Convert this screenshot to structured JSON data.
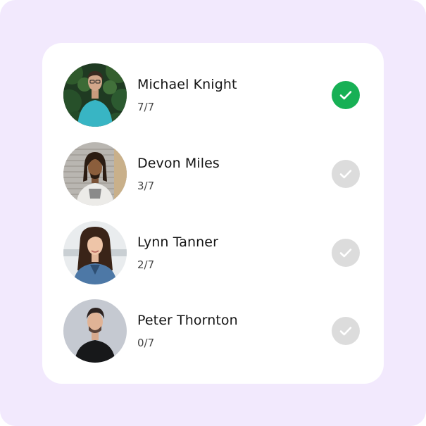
{
  "colors": {
    "background": "#f2e9fd",
    "card": "#ffffff",
    "check_done": "#17b055",
    "check_pending": "#dcdcdc"
  },
  "members": [
    {
      "name": "Michael Knight",
      "score": "7/7",
      "completed": true,
      "avatar": "man-teal-shirt-foliage-photo"
    },
    {
      "name": "Devon Miles",
      "score": "3/7",
      "completed": false,
      "avatar": "man-dreadlocks-grey-shutter-photo"
    },
    {
      "name": "Lynn Tanner",
      "score": "2/7",
      "completed": false,
      "avatar": "woman-denim-jacket-photo"
    },
    {
      "name": "Peter Thornton",
      "score": "0/7",
      "completed": false,
      "avatar": "man-black-tshirt-grey-photo"
    }
  ]
}
